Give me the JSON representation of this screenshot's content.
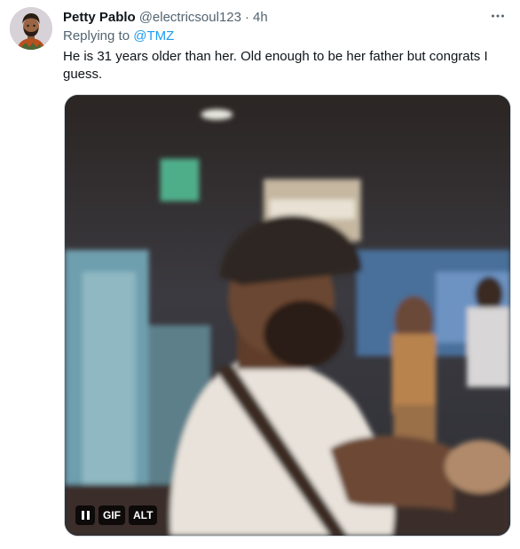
{
  "tweet": {
    "author_name": "Petty Pablo",
    "author_handle": "@electricsoul123",
    "separator": "·",
    "time": "4h",
    "replying_prefix": "Replying to",
    "replying_to": "@TMZ",
    "text": "He is 31 years older than her. Old enough to be her father but congrats I guess."
  },
  "media": {
    "type": "gif",
    "pause_icon": "pause-icon",
    "gif_label": "GIF",
    "alt_label": "ALT"
  },
  "icons": {
    "more": "more-horizontal-icon",
    "avatar": "avatar-illustration"
  },
  "colors": {
    "text": "#0f1419",
    "secondary": "#536471",
    "link": "#1d9bf0",
    "border": "#cfd9de"
  }
}
